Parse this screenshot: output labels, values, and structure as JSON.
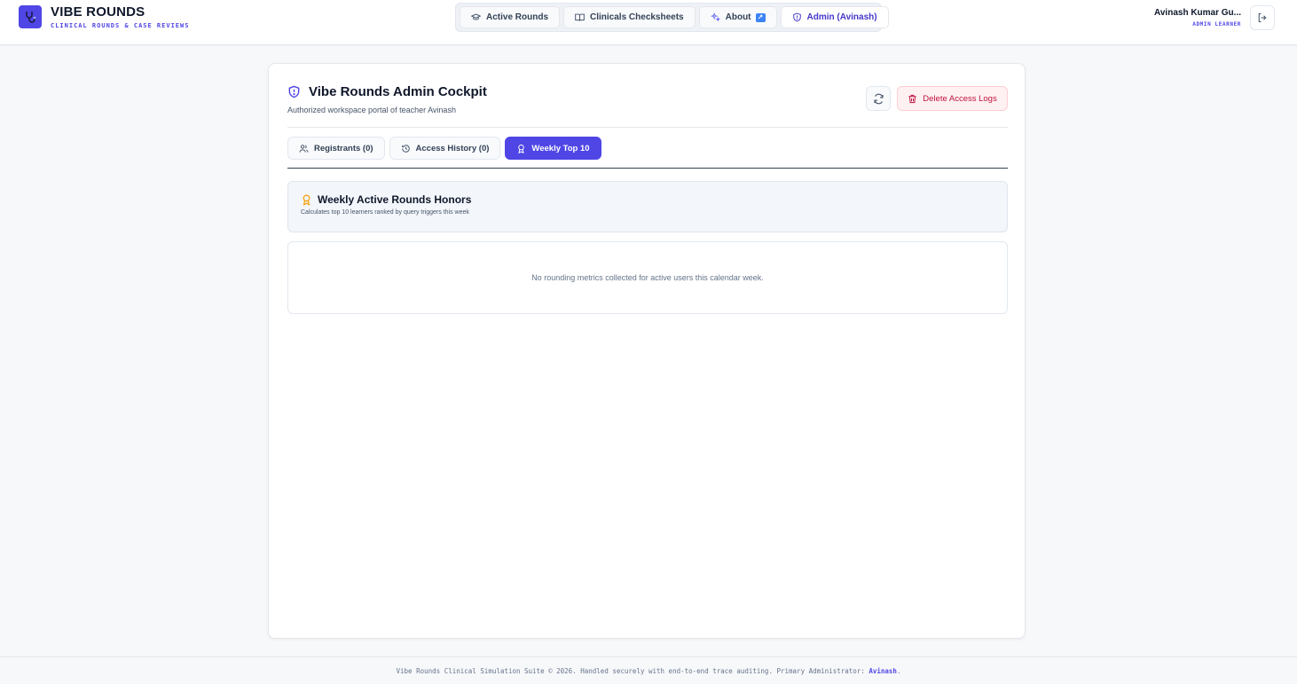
{
  "brand": {
    "title": "VIBE ROUNDS",
    "subtitle": "CLINICAL ROUNDS & CASE REVIEWS"
  },
  "nav": {
    "items": [
      {
        "label": "Active Rounds",
        "icon": "graduation-cap-icon"
      },
      {
        "label": "Clinicals Checksheets",
        "icon": "book-open-icon"
      },
      {
        "label": "About",
        "icon": "sparkles-icon",
        "badge": "↗"
      },
      {
        "label": "Admin (Avinash)",
        "icon": "shield-icon"
      }
    ]
  },
  "user": {
    "name": "Avinash Kumar Gu...",
    "role": "ADMIN LEARNER"
  },
  "cockpit": {
    "title": "Vibe Rounds Admin Cockpit",
    "subtitle": "Authorized workspace portal of teacher Avinash",
    "delete_label": "Delete Access Logs"
  },
  "tabs": [
    {
      "label": "Registrants (0)",
      "icon": "users-icon"
    },
    {
      "label": "Access History (0)",
      "icon": "history-icon"
    },
    {
      "label": "Weekly Top 10",
      "icon": "award-icon",
      "active": true
    }
  ],
  "honors": {
    "title": "Weekly Active Rounds Honors",
    "subtitle": "Calculates top 10 learners ranked by query triggers this week"
  },
  "empty_state": "No rounding metrics collected for active users this calendar week.",
  "footer": {
    "text": "Vibe Rounds Clinical Simulation Suite © 2026. Handled securely with end-to-end trace auditing. Primary Administrator: ",
    "admin": "Avinash",
    "end": "."
  },
  "colors": {
    "accent": "#4f46e5",
    "danger": "#be123c",
    "award": "#f59e0b"
  }
}
